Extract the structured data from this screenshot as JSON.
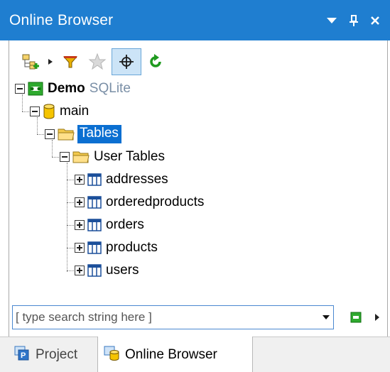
{
  "window": {
    "title": "Online Browser",
    "buttons": {
      "menu_icon": "triangle-down-icon",
      "pin_icon": "pin-icon",
      "close_icon": "close-icon"
    }
  },
  "toolbar": {
    "items": [
      {
        "name": "add-datasource-icon"
      },
      {
        "name": "dropdown-arrow-icon"
      },
      {
        "name": "filter-icon"
      },
      {
        "name": "favorites-star-icon"
      },
      {
        "name": "locate-crosshair-icon",
        "active": true
      },
      {
        "name": "refresh-icon"
      }
    ]
  },
  "tree": {
    "root": {
      "label": "Demo",
      "sublabel": "SQLite"
    },
    "schema": {
      "label": "main"
    },
    "tables_folder": {
      "label": "Tables"
    },
    "user_tables": {
      "label": "User Tables"
    },
    "tables": [
      "addresses",
      "orderedproducts",
      "orders",
      "products",
      "users"
    ]
  },
  "search": {
    "placeholder": "[ type search string here ]"
  },
  "tabs": [
    {
      "label": "Project",
      "active": false
    },
    {
      "label": "Online Browser",
      "active": true
    }
  ],
  "colors": {
    "title_bar": "#1f7ed0",
    "selection": "#0b6fd1",
    "tab_strip": "#f0f0f0"
  }
}
